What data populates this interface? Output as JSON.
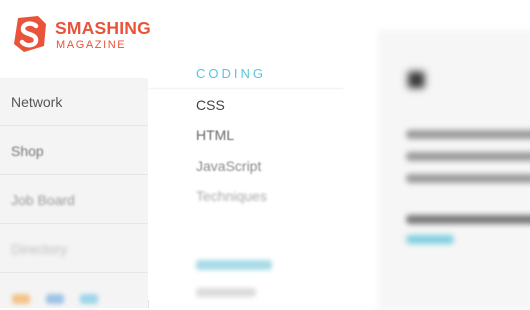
{
  "logo": {
    "word": "SMASHING",
    "sub": "MAGAZINE",
    "color": "#e8533a"
  },
  "sidebar": {
    "items": [
      {
        "label": "Network"
      },
      {
        "label": "Shop"
      },
      {
        "label": "Job Board"
      },
      {
        "label": "Directory"
      }
    ]
  },
  "menu": {
    "heading": "CODING",
    "items": [
      {
        "label": "CSS"
      },
      {
        "label": "HTML"
      },
      {
        "label": "JavaScript"
      },
      {
        "label": "Techniques"
      }
    ],
    "heading_color": "#55c6dc"
  },
  "colors": {
    "accent": "#55c6dc",
    "brand": "#e8533a"
  }
}
